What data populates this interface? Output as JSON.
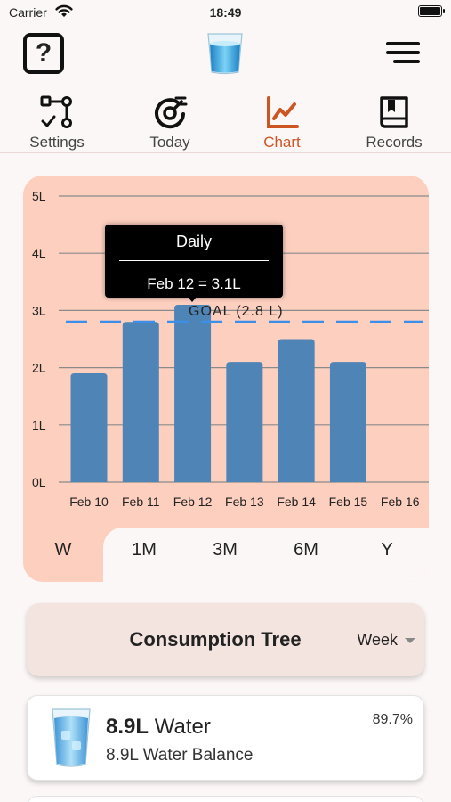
{
  "status_bar": {
    "carrier": "Carrier",
    "time": "18:49",
    "wifi_icon": "wifi-icon",
    "battery_icon": "battery-icon"
  },
  "header": {
    "help_label": "?",
    "help_icon": "question-icon",
    "logo_icon": "water-glass-icon",
    "menu_icon": "menu-icon"
  },
  "tabs": [
    {
      "label": "Settings",
      "icon": "flow-settings-icon",
      "active": false
    },
    {
      "label": "Today",
      "icon": "today-gauge-icon",
      "active": false
    },
    {
      "label": "Chart",
      "icon": "chart-line-icon",
      "active": true
    },
    {
      "label": "Records",
      "icon": "book-icon",
      "active": false
    }
  ],
  "colors": {
    "accent": "#cc5522",
    "chart_bg": "#fdcfbf",
    "bar": "#4f84b7",
    "goal_line": "#3b8fe8"
  },
  "chart_data": {
    "type": "bar",
    "categories": [
      "Feb 10",
      "Feb 11",
      "Feb 12",
      "Feb 13",
      "Feb 14",
      "Feb 15",
      "Feb 16"
    ],
    "values": [
      1.9,
      2.8,
      3.1,
      2.1,
      2.5,
      2.1,
      0
    ],
    "ylim": [
      0,
      5
    ],
    "yticks": [
      "0L",
      "1L",
      "2L",
      "3L",
      "4L",
      "5L"
    ],
    "grid": true,
    "goal": {
      "value": 2.8,
      "label": "GOAL (2.8 L)"
    },
    "tooltip": {
      "title": "Daily",
      "text": "Feb 12 = 3.1L"
    }
  },
  "ranges": [
    {
      "label": "W",
      "selected": true
    },
    {
      "label": "1M",
      "selected": false
    },
    {
      "label": "3M",
      "selected": false
    },
    {
      "label": "6M",
      "selected": false
    },
    {
      "label": "Y",
      "selected": false
    }
  ],
  "consumption_tree": {
    "title": "Consumption Tree",
    "period": "Week"
  },
  "water_entry": {
    "amount": "8.9L",
    "name": "Water",
    "percent": "89.7%",
    "balance_amount": "8.9L",
    "balance_label": "Water Balance",
    "icon": "water-glass-icon"
  }
}
